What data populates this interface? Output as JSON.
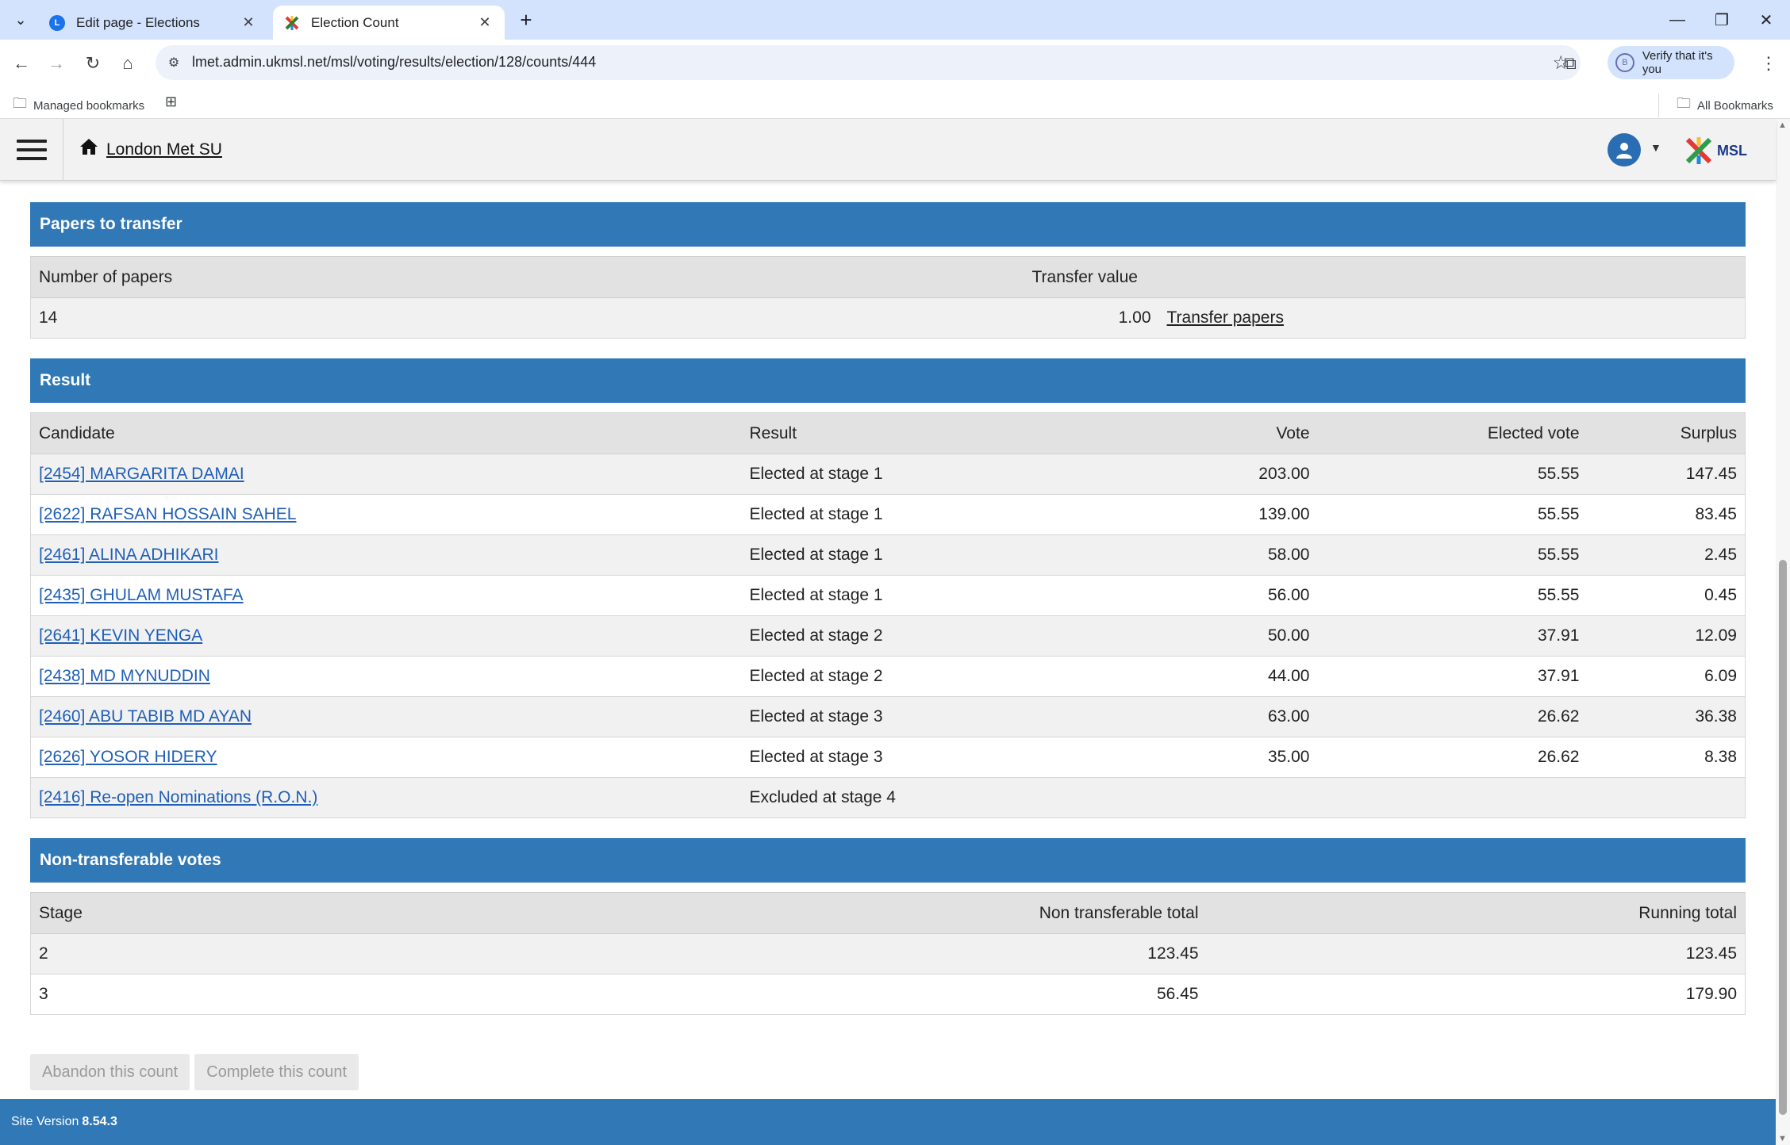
{
  "browser": {
    "tabs": [
      {
        "title": "Edit page - Elections",
        "favicon": "L"
      },
      {
        "title": "Election Count",
        "favicon": "msl-x"
      }
    ],
    "url": "lmet.admin.ukmsl.net/msl/voting/results/election/128/counts/444",
    "verify_label": "Verify that it's you",
    "bookmarks": {
      "managed": "Managed bookmarks",
      "all": "All Bookmarks"
    }
  },
  "header": {
    "site_title": "London Met SU",
    "logo_text": "MSL"
  },
  "papers_to_transfer": {
    "heading": "Papers to transfer",
    "col_number": "Number of papers",
    "col_value": "Transfer value",
    "number": "14",
    "value": "1.00",
    "action": "Transfer papers"
  },
  "result": {
    "heading": "Result",
    "columns": {
      "candidate": "Candidate",
      "result": "Result",
      "vote": "Vote",
      "elected_vote": "Elected vote",
      "surplus": "Surplus"
    },
    "rows": [
      {
        "candidate": "[2454] MARGARITA DAMAI",
        "result": "Elected at stage 1",
        "vote": "203.00",
        "elected_vote": "55.55",
        "surplus": "147.45"
      },
      {
        "candidate": "[2622] RAFSAN HOSSAIN SAHEL",
        "result": "Elected at stage 1",
        "vote": "139.00",
        "elected_vote": "55.55",
        "surplus": "83.45"
      },
      {
        "candidate": "[2461] ALINA ADHIKARI",
        "result": "Elected at stage 1",
        "vote": "58.00",
        "elected_vote": "55.55",
        "surplus": "2.45"
      },
      {
        "candidate": "[2435] GHULAM MUSTAFA",
        "result": "Elected at stage 1",
        "vote": "56.00",
        "elected_vote": "55.55",
        "surplus": "0.45"
      },
      {
        "candidate": "[2641] KEVIN YENGA",
        "result": "Elected at stage 2",
        "vote": "50.00",
        "elected_vote": "37.91",
        "surplus": "12.09"
      },
      {
        "candidate": "[2438] MD MYNUDDIN",
        "result": "Elected at stage 2",
        "vote": "44.00",
        "elected_vote": "37.91",
        "surplus": "6.09"
      },
      {
        "candidate": "[2460] ABU TABIB MD AYAN",
        "result": "Elected at stage 3",
        "vote": "63.00",
        "elected_vote": "26.62",
        "surplus": "36.38"
      },
      {
        "candidate": "[2626] YOSOR HIDERY",
        "result": "Elected at stage 3",
        "vote": "35.00",
        "elected_vote": "26.62",
        "surplus": "8.38"
      },
      {
        "candidate": "[2416] Re-open Nominations (R.O.N.)",
        "result": "Excluded at stage 4",
        "vote": "",
        "elected_vote": "",
        "surplus": ""
      }
    ]
  },
  "non_transferable": {
    "heading": "Non-transferable votes",
    "columns": {
      "stage": "Stage",
      "total": "Non transferable total",
      "running": "Running total"
    },
    "rows": [
      {
        "stage": "2",
        "total": "123.45",
        "running": "123.45"
      },
      {
        "stage": "3",
        "total": "56.45",
        "running": "179.90"
      }
    ]
  },
  "actions": {
    "abandon": "Abandon this count",
    "complete": "Complete this count"
  },
  "footer": {
    "label": "Site Version",
    "version": "8.54.3"
  },
  "colors": {
    "brand_blue": "#3178b7",
    "link_blue": "#1f5fb8"
  }
}
